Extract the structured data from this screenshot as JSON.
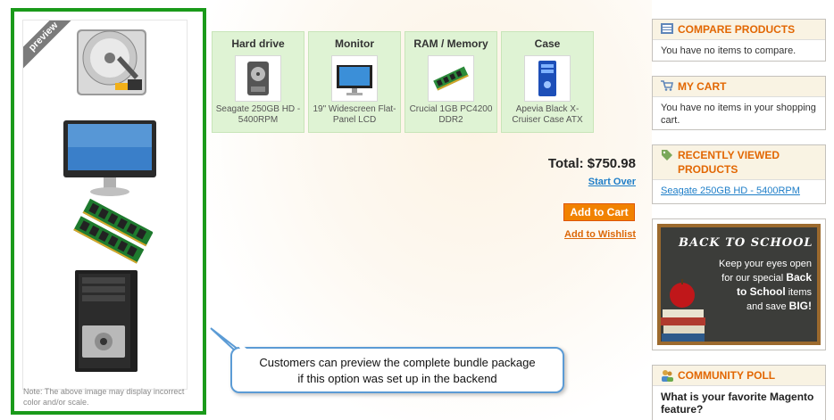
{
  "preview": {
    "ribbon_label": "preview",
    "note": "Note: The above image may display incorrect color and/or scale."
  },
  "bundle_options": [
    {
      "title": "Hard drive",
      "product": "Seagate 250GB HD - 5400RPM"
    },
    {
      "title": "Monitor",
      "product": "19\" Widescreen Flat-Panel LCD"
    },
    {
      "title": "RAM / Memory",
      "product": "Crucial 1GB PC4200 DDR2"
    },
    {
      "title": "Case",
      "product": "Apevia Black X-Cruiser Case ATX"
    }
  ],
  "summary": {
    "total": "Total: $750.98",
    "start_over": "Start Over",
    "add_to_cart": "Add to Cart",
    "add_to_wishlist": "Add to Wishlist"
  },
  "sidebar": {
    "compare": {
      "title": "COMPARE PRODUCTS",
      "body": "You have no items to compare."
    },
    "cart": {
      "title": "MY CART",
      "body": "You have no items in your shopping cart."
    },
    "recent": {
      "title": "RECENTLY VIEWED PRODUCTS",
      "item": "Seagate 250GB HD - 5400RPM"
    },
    "promo": {
      "title": "BACK TO SCHOOL",
      "line1": "Keep your eyes open",
      "line2a": "for our special ",
      "line2b": "Back",
      "line3": "to School",
      "line3b": " items",
      "line4a": "and save ",
      "line4b": "BIG!"
    },
    "poll": {
      "title": "COMMUNITY POLL",
      "question": "What is your favorite Magento feature?"
    }
  },
  "callout": {
    "line1": "Customers can preview the complete bundle package",
    "line2": "if this option was set up in the backend"
  },
  "colors": {
    "highlight_border": "#1a9a1a",
    "callout_border": "#5b9bd5",
    "accent": "#e26703"
  }
}
